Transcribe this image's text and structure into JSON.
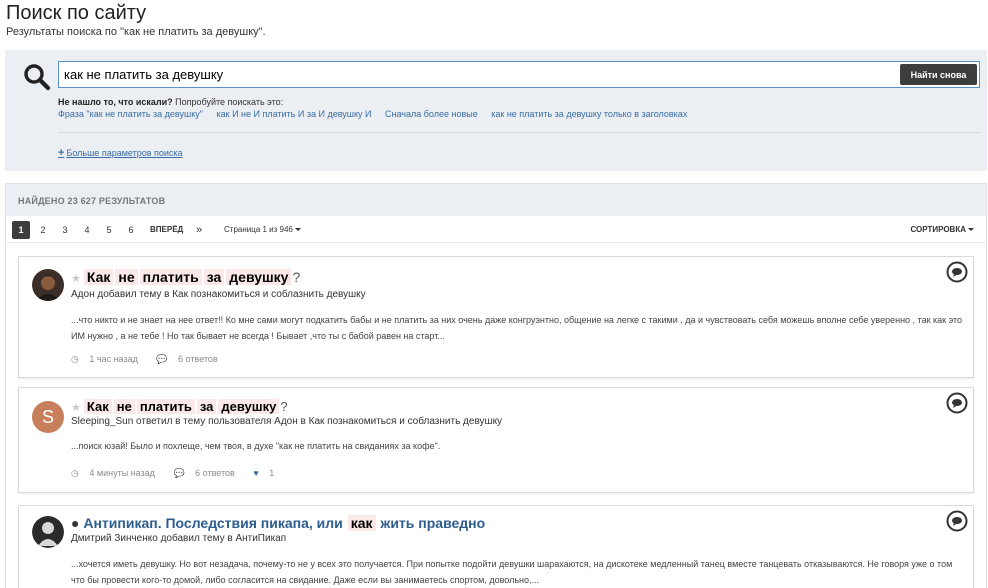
{
  "header": {
    "title": "Поиск по сайту",
    "subtitle": "Результаты поиска по \"как не платить за девушку\"."
  },
  "search": {
    "value": "как не платить за девушку",
    "button_label": "Найти снова",
    "not_found_bold": "Не нашло то, что искали?",
    "not_found_rest": " Попробуйте поискать это:",
    "suggestions": [
      "Фраза \"как не платить за девушку\"",
      "как И не И платить И за И девушку И",
      "Сначала более новые",
      "как не платить за девушку только в заголовках"
    ],
    "more_params": "Больше параметров поиска"
  },
  "results": {
    "count_label": "НАЙДЕНО 23 627 РЕЗУЛЬТАТОВ",
    "pages": [
      "1",
      "2",
      "3",
      "4",
      "5",
      "6"
    ],
    "next_label": "ВПЕРЁД",
    "last_label": "»",
    "page_of": "Страница 1 из 946",
    "sort_label": "СОРТИРОВКА",
    "items": [
      {
        "title_parts": [
          "Как",
          "не",
          "платить",
          "за",
          "девушку"
        ],
        "title_suffix": "?",
        "meta": "Адон добавил тему в Как познакомиться и соблазнить девушку",
        "snippet": "...что никто и не знает на нее ответ!! Ко мне сами могут подкатить бабы и не платить за них очень даже конгруэнтно, общение на легке с такими , да и чувствовать себя можешь вполне себе уверенно , так как это ИМ нужно , а не тебе ! Но так бывает не всегда ! Бывает ,что ты с бабой равен на старт...",
        "time": "1 час назад",
        "replies": "6 ответов"
      },
      {
        "title_parts": [
          "Как",
          "не",
          "платить",
          "за",
          "девушку"
        ],
        "title_suffix": "?",
        "meta": "Sleeping_Sun ответил в тему пользователя Адон в Как познакомиться и соблазнить девушку",
        "snippet": "...поиск юзай! Было и похлеще, чем твоя, в духе \"как не платить на свиданиях за кофе\".",
        "time": "4 минуты назад",
        "replies": "6 ответов",
        "likes": "1"
      },
      {
        "title_prefix": "Антипикап. Последствия пикапа, или",
        "title_hl": "как",
        "title_rest": "жить праведно",
        "meta": "Дмитрий Зинченко добавил тему в АнтиПикап",
        "snippet": "...хочется иметь девушку. Но вот незадача, почему-то не у всех это получается. При попытке подойти девушки шарахаются, на дискотеке медленный танец вместе танцевать отказываются. Не говоря уже о том что бы провести кого-то домой, либо согласится на свидание. Даже если вы занимаетесь спортом, довольно,..."
      }
    ]
  },
  "colors": {
    "accent": "#3a6ea5",
    "panel": "#ebeef2",
    "highlight": "#fbe9e9",
    "button": "#3d3d3d"
  }
}
